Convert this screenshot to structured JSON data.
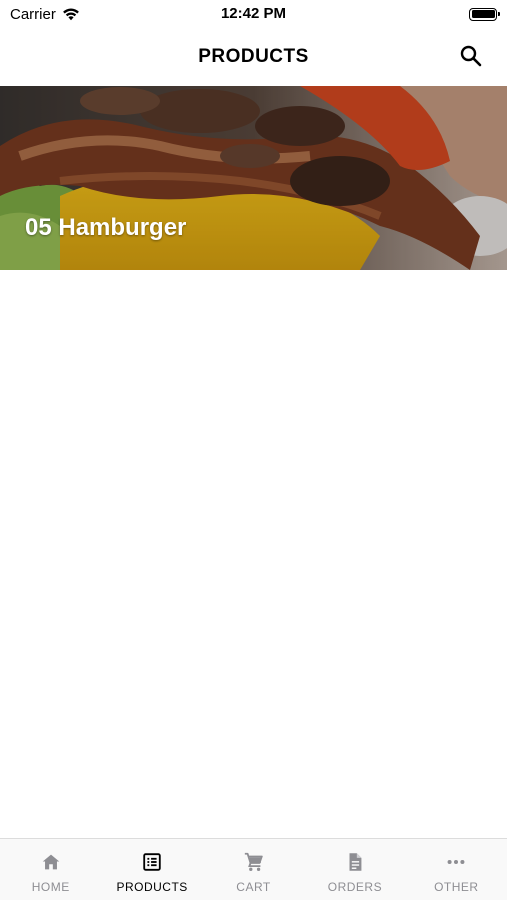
{
  "status_bar": {
    "carrier": "Carrier",
    "time": "12:42 PM",
    "battery_level": 1.0
  },
  "header": {
    "title": "PRODUCTS",
    "search_icon": "search-icon"
  },
  "products": [
    {
      "name": "05 Hamburger",
      "image": "hamburger-photo"
    }
  ],
  "tab_bar": {
    "active_color": "#000000",
    "inactive_color": "#8e8e93",
    "tabs": [
      {
        "label": "HOME",
        "icon": "home-icon",
        "active": false
      },
      {
        "label": "PRODUCTS",
        "icon": "list-icon",
        "active": true
      },
      {
        "label": "CART",
        "icon": "cart-icon",
        "active": false
      },
      {
        "label": "ORDERS",
        "icon": "document-icon",
        "active": false
      },
      {
        "label": "OTHER",
        "icon": "more-icon",
        "active": false
      }
    ]
  }
}
